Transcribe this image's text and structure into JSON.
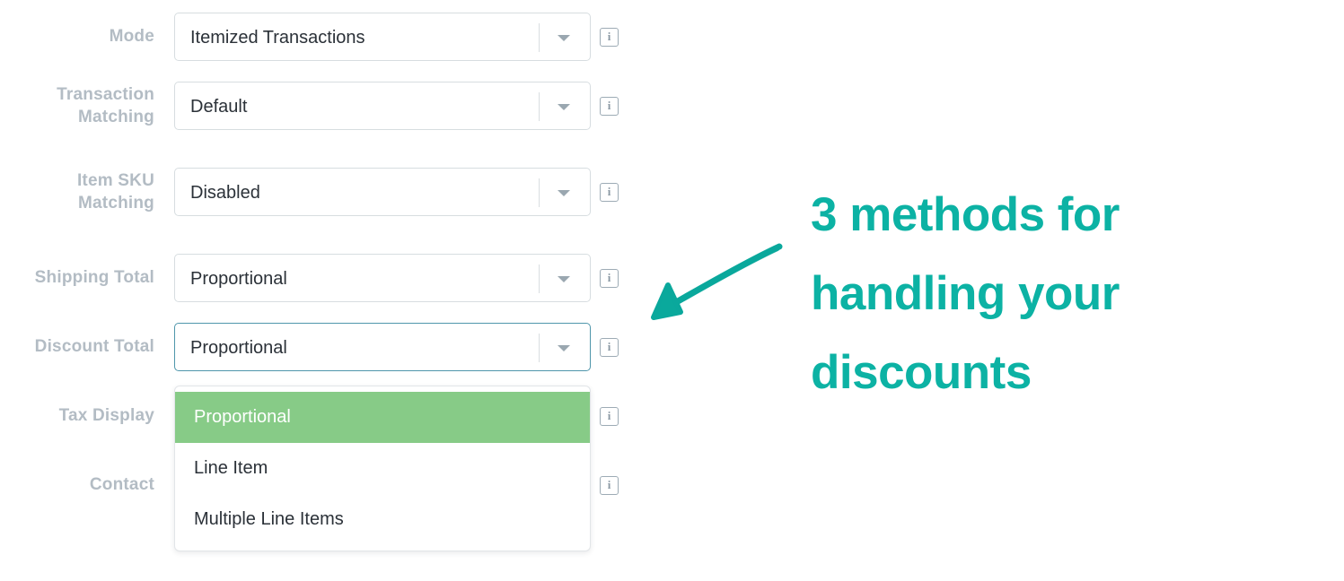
{
  "accent_color": "#0cb2a4",
  "label_color": "#b3bcc4",
  "focus_border_color": "#4f96ab",
  "option_highlight_color": "#87cb87",
  "form": {
    "rows": [
      {
        "label": "Mode",
        "value": "Itemized Transactions",
        "info": "i"
      },
      {
        "label": "Transaction\nMatching",
        "value": "Default",
        "info": "i"
      },
      {
        "label": "Item SKU\nMatching",
        "value": "Disabled",
        "info": "i"
      },
      {
        "label": "Shipping Total",
        "value": "Proportional",
        "info": "i"
      },
      {
        "label": "Discount Total",
        "value": "Proportional",
        "info": "i"
      },
      {
        "label": "Tax Display",
        "value": "",
        "info": "i"
      },
      {
        "label": "Contact",
        "value": "",
        "info": "i"
      }
    ]
  },
  "dropdown": {
    "open_for": "Discount Total",
    "options": [
      {
        "label": "Proportional",
        "selected": true
      },
      {
        "label": "Line Item",
        "selected": false
      },
      {
        "label": "Multiple Line Items",
        "selected": false
      }
    ]
  },
  "annotation": {
    "line1": "3 methods for",
    "line2": "handling your",
    "line3": "discounts",
    "arrow": "hand-drawn-arrow-pointing-down-left"
  }
}
